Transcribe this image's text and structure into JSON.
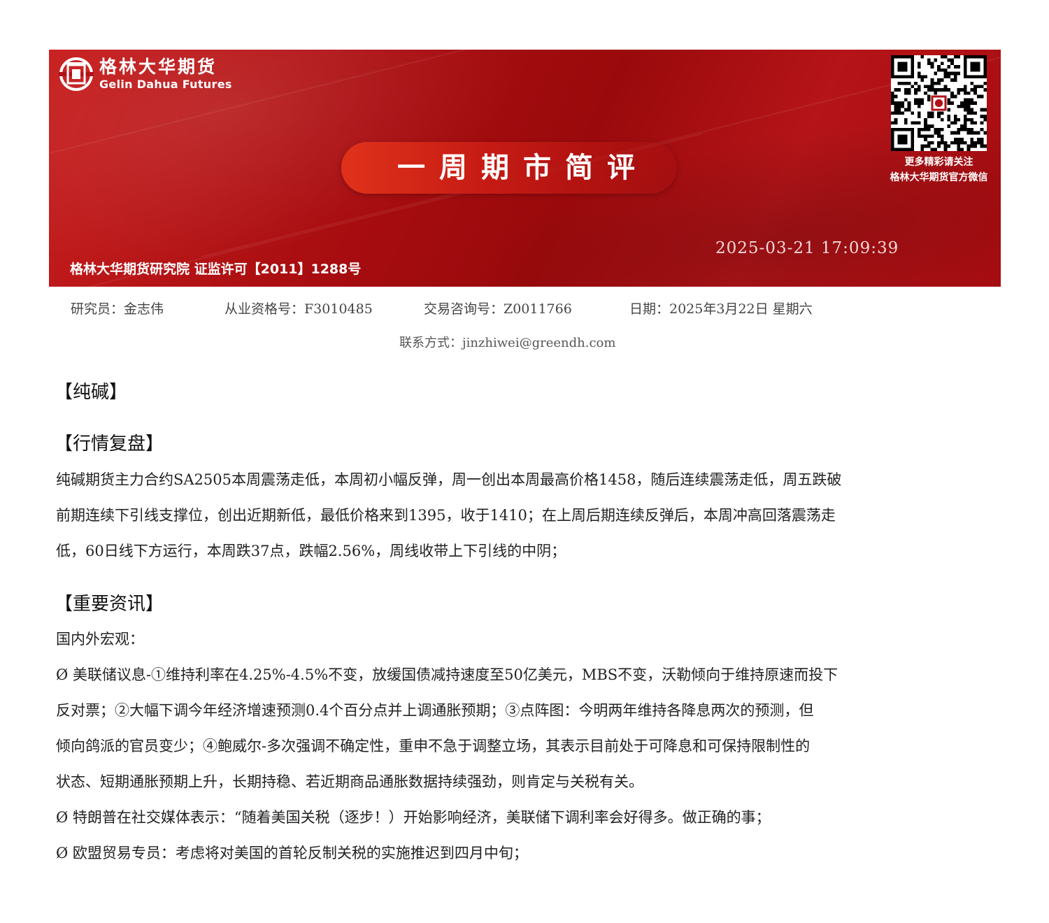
{
  "banner": {
    "logo_cn": "格林大华期货",
    "logo_en": "Gelin Dahua Futures",
    "title": "一周期市简评",
    "qr_caption_line1": "更多精彩请关注",
    "qr_caption_line2": "格林大华期货官方微信",
    "timestamp": "2025-03-21 17:09:39",
    "institute": "格林大华期货研究院  证监许可【2011】1288号",
    "brand_color": "#b0121a"
  },
  "meta": {
    "researcher": "研究员：金志伟",
    "qualification": "从业资格号：F3010485",
    "consult": "交易咨询号：Z0011766",
    "date": "日期：2025年3月22日 星期六",
    "contact": "联系方式：jinzhiwei@greendh.com"
  },
  "sections": {
    "commodity": "【纯碱】",
    "review_heading": "【行情复盘】",
    "review_lines": [
      "纯碱期货主力合约SA2505本周震荡走低，本周初小幅反弹，周一创出本周最高价格1458，随后连续震荡走低，周五跌破",
      "前期连续下引线支撑位，创出近期新低，最低价格来到1395，收于1410；在上周后期连续反弹后，本周冲高回落震荡走",
      "低，60日线下方运行，本周跌37点，跌幅2.56%，周线收带上下引线的中阴；"
    ],
    "news_heading": "【重要资讯】",
    "news_lines": [
      "国内外宏观：",
      "Ø 美联储议息-①维持利率在4.25%-4.5%不变，放缓国债减持速度至50亿美元，MBS不变，沃勒倾向于维持原速而投下",
      "反对票；②大幅下调今年经济增速预测0.4个百分点并上调通胀预期；③点阵图：今明两年维持各降息两次的预测，但",
      "倾向鸽派的官员变少；④鲍威尔-多次强调不确定性，重申不急于调整立场，其表示目前处于可降息和可保持限制性的",
      "状态、短期通胀预期上升，长期持稳、若近期商品通胀数据持续强劲，则肯定与关税有关。",
      "Ø 特朗普在社交媒体表示：“随着美国关税（逐步！）开始影响经济，美联储下调利率会好得多。做正确的事；",
      "Ø 欧盟贸易专员：考虑将对美国的首轮反制关税的实施推迟到四月中旬；"
    ]
  }
}
